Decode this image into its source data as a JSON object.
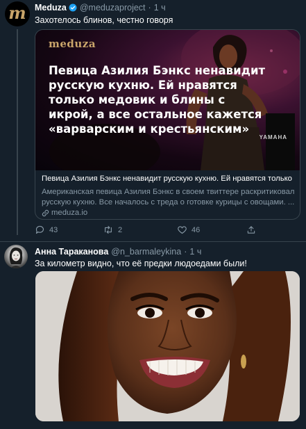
{
  "tweet1": {
    "author_name": "Meduza",
    "handle": "@meduzaproject",
    "dot": "·",
    "time": "1 ч",
    "text": "Захотелось блинов, честно говоря",
    "avatar_glyph": "m",
    "card": {
      "logo": "meduza",
      "headline": "Певица Азилия Бэнкс ненавидит русскую кухню. Ей нравятся только медовик и блины с икрой, а все остальное кажется «варварским и крестьянским»",
      "image_brand": "YAMAHA",
      "title": "Певица Азилия Бэнкс ненавидит русскую кухню. Ей нравятся только ...",
      "desc_line1": "Американская певица Азилия Бэнкс в своем твиттере раскритиковала",
      "desc_line2": "русскую кухню. Все началось с треда о готовке курицы с овощами. ...",
      "domain": "meduza.io"
    },
    "actions": {
      "replies": "43",
      "retweets": "2",
      "likes": "46"
    }
  },
  "tweet2": {
    "author_name": "Анна Тараканова",
    "handle": "@n_barmaleykina",
    "dot": "·",
    "time": "1 ч",
    "text": "За километр видно, что её предки людоедами были!"
  },
  "colors": {
    "background": "#15202b",
    "border": "#38444d",
    "muted": "#8899a6",
    "verified": "#1da1f2",
    "meduza_gold": "#c9a56a"
  }
}
